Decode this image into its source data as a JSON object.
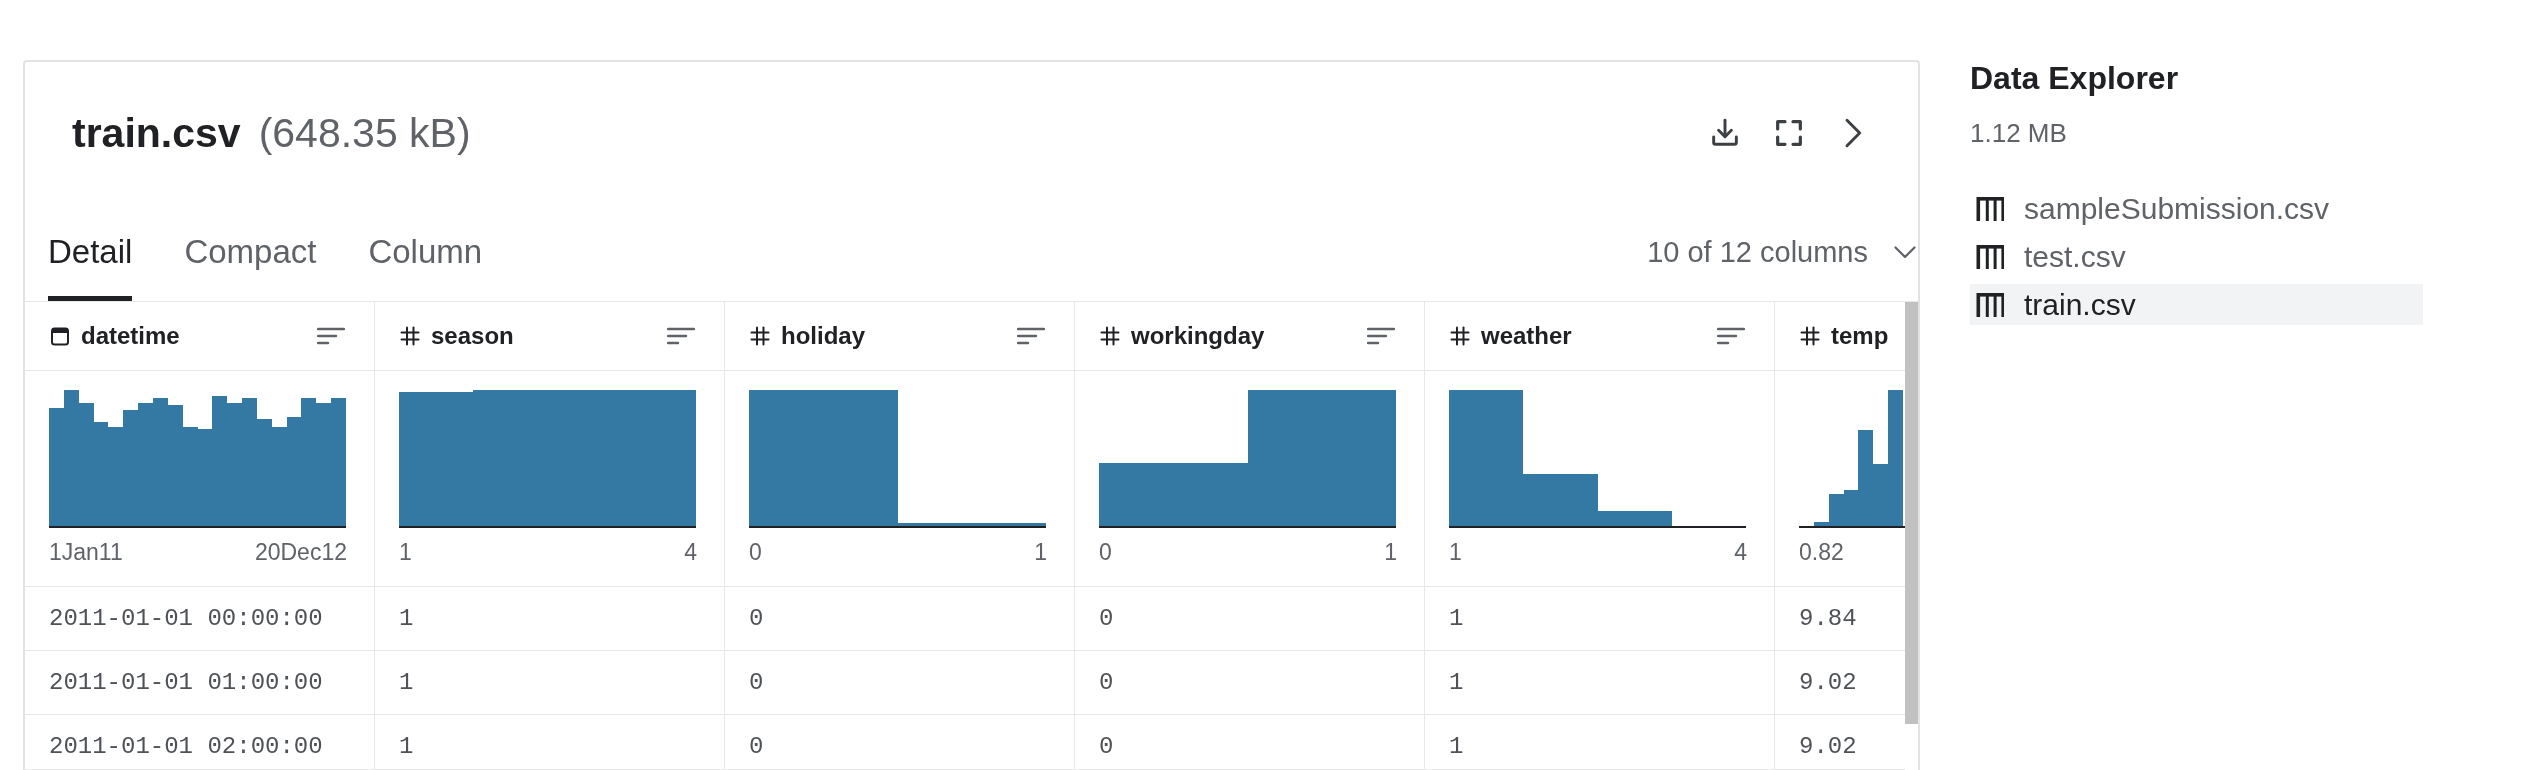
{
  "file": {
    "name": "train.csv",
    "size": "(648.35 kB)"
  },
  "tabs": [
    {
      "label": "Detail",
      "selected": true
    },
    {
      "label": "Compact",
      "selected": false
    },
    {
      "label": "Column",
      "selected": false
    }
  ],
  "column_picker": {
    "label": "10 of 12 columns"
  },
  "table": {
    "columns": [
      {
        "name": "datetime",
        "kind": "datetime",
        "range_start": "1Jan11",
        "range_end": "20Dec12"
      },
      {
        "name": "season",
        "kind": "numeric",
        "range_start": "1",
        "range_end": "4"
      },
      {
        "name": "holiday",
        "kind": "numeric",
        "range_start": "0",
        "range_end": "1"
      },
      {
        "name": "workingday",
        "kind": "numeric",
        "range_start": "0",
        "range_end": "1"
      },
      {
        "name": "weather",
        "kind": "numeric",
        "range_start": "1",
        "range_end": "4"
      },
      {
        "name": "temp",
        "kind": "numeric",
        "range_start": "0.82"
      }
    ],
    "rows": [
      [
        "2011-01-01 00:00:00",
        "1",
        "0",
        "0",
        "1",
        "9.84"
      ],
      [
        "2011-01-01 01:00:00",
        "1",
        "0",
        "0",
        "1",
        "9.02"
      ],
      [
        "2011-01-01 02:00:00",
        "1",
        "0",
        "0",
        "1",
        "9.02"
      ]
    ]
  },
  "explorer": {
    "title": "Data Explorer",
    "size": "1.12 MB",
    "files": [
      {
        "name": "sampleSubmission.csv",
        "selected": false
      },
      {
        "name": "test.csv",
        "selected": false
      },
      {
        "name": "train.csv",
        "selected": true
      }
    ]
  }
}
